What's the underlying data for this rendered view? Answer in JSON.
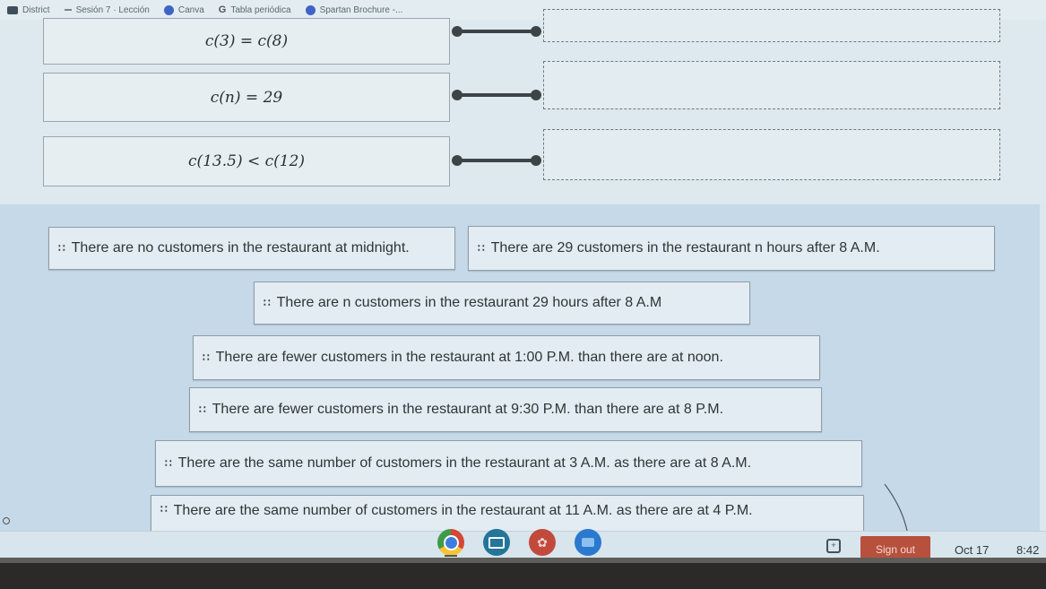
{
  "bookmarks": [
    {
      "icon": "classroom-icon",
      "label": "District"
    },
    {
      "icon": "dash-icon",
      "label": "Sesión 7 · Lección"
    },
    {
      "icon": "canva-icon",
      "label": "Canva"
    },
    {
      "icon": "google-icon",
      "label": "Tabla periódica"
    },
    {
      "icon": "canva-icon",
      "label": "Spartan Brochure -..."
    }
  ],
  "matching": {
    "statements": [
      {
        "expression": "c(3) = c(8)",
        "answer": ""
      },
      {
        "expression": "c(n) = 29",
        "answer": ""
      },
      {
        "expression": "c(13.5) < c(12)",
        "answer": ""
      }
    ]
  },
  "answer_bank": {
    "options": [
      "There are no customers in the restaurant at midnight.",
      "There are 29 customers in the restaurant n hours after 8 A.M.",
      "There are n customers in the restaurant 29 hours after 8 A.M",
      "There are fewer customers in the restaurant at 1:00 P.M. than there are at noon.",
      "There are fewer customers in the restaurant at 9:30 P.M. than there are at 8 P.M.",
      "There are the same number of customers in the restaurant at 3 A.M. as there are at 8 A.M.",
      "There are the same number of customers in the restaurant at 11 A.M. as there are at 4 P.M."
    ]
  },
  "shelf": {
    "apps": [
      "Chrome",
      "Screencast",
      "Brain app",
      "Files"
    ],
    "sign_out_label": "Sign out",
    "date": "Oct 17",
    "time": "8:42"
  }
}
